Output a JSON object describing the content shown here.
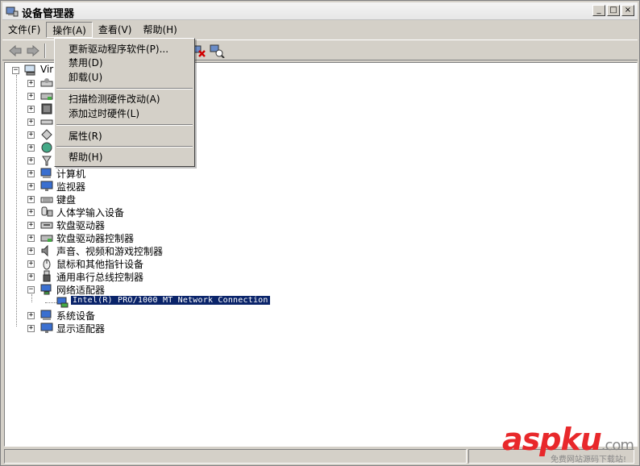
{
  "window": {
    "title": "设备管理器",
    "caption_buttons": [
      "_",
      "□",
      "×"
    ]
  },
  "menu": [
    {
      "label": "文件(F)"
    },
    {
      "label": "操作(A)"
    },
    {
      "label": "查看(V)"
    },
    {
      "label": "帮助(H)"
    }
  ],
  "dropdown": {
    "items": [
      "更新驱动程序软件(P)...",
      "禁用(D)",
      "卸载(U)",
      "扫描检测硬件改动(A)",
      "添加过时硬件(L)",
      "属性(R)",
      "帮助(H)"
    ]
  },
  "tree": {
    "root": "Vir",
    "categories": [
      "计算机",
      "监视器",
      "键盘",
      "人体学输入设备",
      "软盘驱动器",
      "软盘驱动器控制器",
      "声音、视频和游戏控制器",
      "鼠标和其他指针设备",
      "通用串行总线控制器",
      "网络适配器",
      "系统设备",
      "显示适配器"
    ],
    "selected_child": "Intel(R) PRO/1000 MT Network Connection"
  },
  "watermark": {
    "main": "aspku",
    "suffix": ".com",
    "sub": "免费网站源码下载站!"
  },
  "colors": {
    "selection": "#0a246a",
    "watermark_red": "#e8282b",
    "watermark_gray": "#888888"
  }
}
